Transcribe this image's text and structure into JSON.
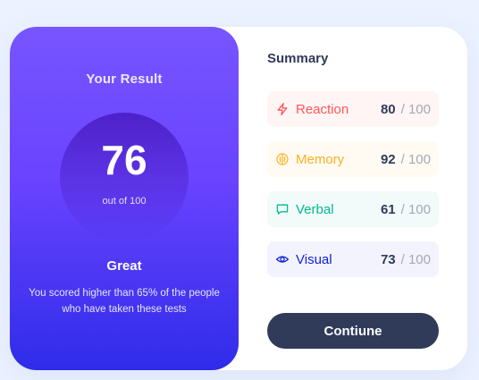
{
  "result": {
    "title": "Your Result",
    "score": "76",
    "max_label": "out of 100",
    "rating": "Great",
    "description": "You scored higher than 65% of the people who have taken these tests"
  },
  "summary": {
    "title": "Summary",
    "items": [
      {
        "label": "Reaction",
        "score": "80",
        "max": "/ 100",
        "icon": "lightning-icon",
        "color": "#FF5757",
        "background": "#FFF5F5"
      },
      {
        "label": "Memory",
        "score": "92",
        "max": "/ 100",
        "icon": "brain-icon",
        "color": "#FFB01F",
        "background": "#FFFBF3"
      },
      {
        "label": "Verbal",
        "score": "61",
        "max": "/ 100",
        "icon": "chat-bubble-icon",
        "color": "#00BB8F",
        "background": "#F2FBFA"
      },
      {
        "label": "Visual",
        "score": "73",
        "max": "/ 100",
        "icon": "eye-icon",
        "color": "#1125D6",
        "background": "#F3F3FD"
      }
    ],
    "button_label": "Contiune"
  },
  "colors": {
    "page_background": "#ECF2FF",
    "gradient_top": "#7755FF",
    "gradient_bottom": "#2F2CE9",
    "dark_navy": "#303B5A",
    "muted_gray": "#A5A8B7"
  }
}
